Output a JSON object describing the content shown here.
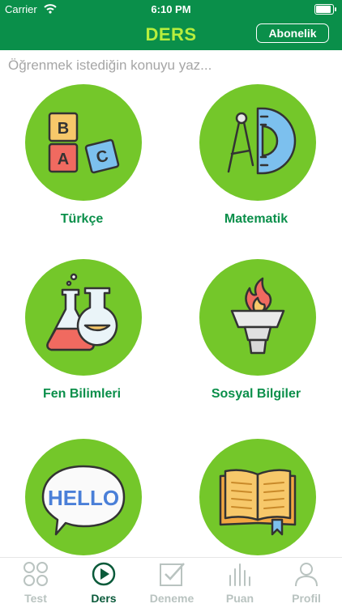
{
  "status_bar": {
    "carrier": "Carrier",
    "time": "6:10 PM"
  },
  "header": {
    "title": "DERS",
    "subscribe_label": "Abonelik"
  },
  "search": {
    "placeholder": "Öğrenmek istediğin konuyu yaz..."
  },
  "subjects": [
    {
      "label": "Türkçe",
      "icon": "abc-blocks-icon"
    },
    {
      "label": "Matematik",
      "icon": "compass-ruler-icon"
    },
    {
      "label": "Fen Bilimleri",
      "icon": "lab-flasks-icon"
    },
    {
      "label": "Sosyal Bilgiler",
      "icon": "torch-icon"
    },
    {
      "label": "",
      "icon": "hello-speech-bubble-icon"
    },
    {
      "label": "",
      "icon": "open-book-icon"
    }
  ],
  "abc_blocks": [
    "B",
    "A",
    "C"
  ],
  "hello_text": "HELLO",
  "tabs": [
    {
      "label": "Test",
      "icon": "grid-circles-icon",
      "active": false
    },
    {
      "label": "Ders",
      "icon": "play-circle-icon",
      "active": true
    },
    {
      "label": "Deneme",
      "icon": "check-square-icon",
      "active": false
    },
    {
      "label": "Puan",
      "icon": "bar-chart-icon",
      "active": false
    },
    {
      "label": "Profil",
      "icon": "user-icon",
      "active": false
    }
  ],
  "colors": {
    "primary": "#0a8f4a",
    "title_accent": "#b7ee3d",
    "circle": "#74c72a",
    "tab_active": "#0a5a3a",
    "tab_inactive": "#b9c3c0"
  }
}
